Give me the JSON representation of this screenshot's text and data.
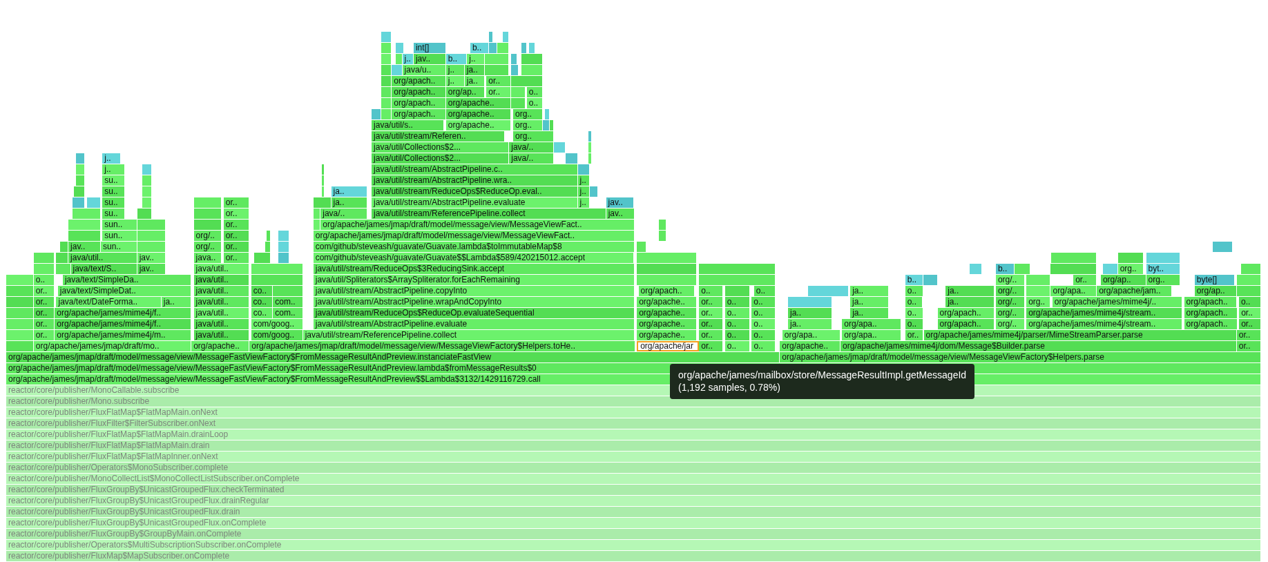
{
  "flame_graph": {
    "rows": [
      {
        "frames": [
          {
            "kind": "inlined"
          },
          {
            "kind": "inlined"
          },
          {
            "kind": "inlined"
          }
        ]
      },
      {
        "frames": [
          {
            "kind": "java"
          },
          {
            "kind": "inlined"
          },
          {
            "kind": "inlined",
            "label": "int[]"
          },
          {
            "kind": "inlined",
            "label": "b.."
          },
          {
            "kind": "inlined"
          },
          {
            "kind": "java"
          },
          {
            "kind": "inlined"
          },
          {
            "kind": "inlined"
          }
        ]
      },
      {
        "frames": [
          {
            "kind": "java"
          },
          {
            "kind": "java"
          },
          {
            "kind": "inlined",
            "label": "j.."
          },
          {
            "kind": "java",
            "label": "jav.."
          },
          {
            "kind": "inlined",
            "label": "b.."
          },
          {
            "kind": "java",
            "label": "j.."
          },
          {
            "kind": "java"
          },
          {
            "kind": "inlined"
          },
          {
            "kind": "java"
          }
        ]
      },
      {
        "frames": [
          {
            "kind": "java"
          },
          {
            "kind": "inlined"
          },
          {
            "kind": "java",
            "label": "java/u.."
          },
          {
            "kind": "java",
            "label": "j.."
          },
          {
            "kind": "java",
            "label": "ja.."
          },
          {
            "kind": "java"
          },
          {
            "kind": "inlined"
          },
          {
            "kind": "java"
          }
        ]
      },
      {
        "frames": [
          {
            "kind": "java"
          },
          {
            "kind": "java",
            "label": "org/apach.."
          },
          {
            "kind": "java",
            "label": "j.."
          },
          {
            "kind": "java",
            "label": "ja.."
          },
          {
            "kind": "java",
            "label": "or.."
          },
          {
            "kind": "java"
          }
        ]
      },
      {
        "frames": [
          {
            "kind": "java"
          },
          {
            "kind": "java",
            "label": "org/apach.."
          },
          {
            "kind": "java",
            "label": "org/ap.."
          },
          {
            "kind": "java",
            "label": "or.."
          },
          {
            "kind": "java"
          },
          {
            "kind": "java",
            "label": "o.."
          }
        ]
      },
      {
        "frames": [
          {
            "kind": "java"
          },
          {
            "kind": "java",
            "label": "org/apach.."
          },
          {
            "kind": "java",
            "label": "org/apache.."
          },
          {
            "kind": "java"
          },
          {
            "kind": "java",
            "label": "o.."
          }
        ]
      },
      {
        "frames": [
          {
            "kind": "inlined"
          },
          {
            "kind": "java"
          },
          {
            "kind": "java",
            "label": "org/apach.."
          },
          {
            "kind": "java",
            "label": "org/apache.."
          },
          {
            "kind": "java",
            "label": "org.."
          },
          {
            "kind": "inlined"
          }
        ]
      },
      {
        "frames": [
          {
            "kind": "java",
            "label": "java/util/s.."
          },
          {
            "kind": "java",
            "label": "org/apache.."
          },
          {
            "kind": "java",
            "label": "org.."
          },
          {
            "kind": "inlined"
          },
          {
            "kind": "java"
          }
        ]
      },
      {
        "frames": [
          {
            "kind": "java",
            "label": "java/util/stream/Referen.."
          },
          {
            "kind": "java",
            "label": "org.."
          },
          {
            "kind": "inlined"
          }
        ]
      },
      {
        "frames": [
          {
            "kind": "java",
            "label": "java/util/Collections$2..."
          },
          {
            "kind": "java",
            "label": "java/.."
          },
          {
            "kind": "inlined"
          },
          {
            "kind": "java"
          }
        ]
      },
      {
        "frames": [
          {
            "kind": "inlined"
          },
          {
            "kind": "inlined",
            "label": "j.."
          },
          {
            "kind": "java",
            "label": "java/util/Collections$2..."
          },
          {
            "kind": "java",
            "label": "java/.."
          },
          {
            "kind": "inlined"
          },
          {
            "kind": "java"
          }
        ]
      },
      {
        "frames": [
          {
            "kind": "java"
          },
          {
            "kind": "java",
            "label": "j.."
          },
          {
            "kind": "inlined"
          },
          {
            "kind": "java"
          },
          {
            "kind": "java",
            "label": "java/util/stream/AbstractPipeline.c.."
          },
          {
            "kind": "inlined"
          }
        ]
      },
      {
        "frames": [
          {
            "kind": "java"
          },
          {
            "kind": "java",
            "label": "su.."
          },
          {
            "kind": "java"
          },
          {
            "kind": "java"
          },
          {
            "kind": "java",
            "label": "java/util/stream/AbstractPipeline.wra.."
          },
          {
            "kind": "java",
            "label": "j.."
          }
        ]
      },
      {
        "frames": [
          {
            "kind": "java"
          },
          {
            "kind": "java",
            "label": "su.."
          },
          {
            "kind": "java"
          },
          {
            "kind": "java"
          },
          {
            "kind": "inlined",
            "label": "ja.."
          },
          {
            "kind": "java",
            "label": "java/util/stream/ReduceOps$ReduceOp.eval.."
          },
          {
            "kind": "java",
            "label": "j.."
          },
          {
            "kind": "inlined"
          }
        ]
      },
      {
        "frames": [
          {
            "kind": "inlined"
          },
          {
            "kind": "inlined"
          },
          {
            "kind": "java",
            "label": "su.."
          },
          {
            "kind": "java"
          },
          {
            "kind": "java"
          },
          {
            "kind": "java",
            "label": "or.."
          },
          {
            "kind": "java"
          },
          {
            "kind": "java",
            "label": "ja.."
          },
          {
            "kind": "java",
            "label": "java/util/stream/AbstractPipeline.evaluate"
          },
          {
            "kind": "java",
            "label": "j.."
          },
          {
            "kind": "inlined",
            "label": "jav.."
          }
        ]
      },
      {
        "frames": [
          {
            "kind": "java"
          },
          {
            "kind": "java",
            "label": "su.."
          },
          {
            "kind": "java"
          },
          {
            "kind": "java"
          },
          {
            "kind": "java",
            "label": "or.."
          },
          {
            "kind": "java"
          },
          {
            "kind": "java",
            "label": "java/.."
          },
          {
            "kind": "java",
            "label": "java/util/stream/ReferencePipeline.collect"
          },
          {
            "kind": "java",
            "label": "jav.."
          }
        ]
      },
      {
        "frames": [
          {
            "kind": "java"
          },
          {
            "kind": "java",
            "label": "sun.."
          },
          {
            "kind": "java"
          },
          {
            "kind": "java"
          },
          {
            "kind": "java",
            "label": "or.."
          },
          {
            "kind": "java"
          },
          {
            "kind": "java",
            "label": "org/apache/james/jmap/draft/model/message/view/MessageViewFact.."
          },
          {
            "kind": "java"
          }
        ]
      },
      {
        "frames": [
          {
            "kind": "java"
          },
          {
            "kind": "java",
            "label": "sun.."
          },
          {
            "kind": "java"
          },
          {
            "kind": "java",
            "label": "org/.."
          },
          {
            "kind": "java",
            "label": "or.."
          },
          {
            "kind": "java"
          },
          {
            "kind": "inlined"
          },
          {
            "kind": "java",
            "label": "org/apache/james/jmap/draft/model/message/view/MessageViewFact.."
          },
          {
            "kind": "java"
          }
        ]
      },
      {
        "frames": [
          {
            "kind": "java"
          },
          {
            "kind": "java",
            "label": "jav.."
          },
          {
            "kind": "java",
            "label": "sun.."
          },
          {
            "kind": "java"
          },
          {
            "kind": "java",
            "label": "org/.."
          },
          {
            "kind": "java",
            "label": "or.."
          },
          {
            "kind": "java"
          },
          {
            "kind": "inlined"
          },
          {
            "kind": "java",
            "label": "com/github/steveash/guavate/Guavate.lambda$toImmutableMap$8"
          },
          {
            "kind": "java"
          },
          {
            "kind": "inlined"
          }
        ]
      },
      {
        "frames": [
          {
            "kind": "java"
          },
          {
            "kind": "java"
          },
          {
            "kind": "java",
            "label": "java/util.."
          },
          {
            "kind": "java",
            "label": "jav.."
          },
          {
            "kind": "java",
            "label": "java.."
          },
          {
            "kind": "java",
            "label": "or.."
          },
          {
            "kind": "java"
          },
          {
            "kind": "inlined"
          },
          {
            "kind": "java",
            "label": "com/github/steveash/guavate/Guavate$$Lambda$589/420215012.accept"
          },
          {
            "kind": "java"
          },
          {
            "kind": "java"
          },
          {
            "kind": "java"
          },
          {
            "kind": "inlined"
          }
        ]
      },
      {
        "frames": [
          {
            "kind": "java"
          },
          {
            "kind": "java"
          },
          {
            "kind": "java",
            "label": "java/text/S.."
          },
          {
            "kind": "java",
            "label": "jav.."
          },
          {
            "kind": "java",
            "label": "java/util.."
          },
          {
            "kind": "java"
          },
          {
            "kind": "java",
            "label": "java/util/stream/ReduceOps$3ReducingSink.accept"
          },
          {
            "kind": "java"
          },
          {
            "kind": "java"
          },
          {
            "kind": "inlined"
          },
          {
            "kind": "inlined",
            "label": "b.."
          },
          {
            "kind": "java"
          },
          {
            "kind": "java"
          },
          {
            "kind": "inlined"
          },
          {
            "kind": "java",
            "label": "org.."
          },
          {
            "kind": "inlined",
            "label": "byt.."
          },
          {
            "kind": "java"
          }
        ]
      },
      {
        "frames": [
          {
            "kind": "java"
          },
          {
            "kind": "java",
            "label": "o.."
          },
          {
            "kind": "java",
            "label": "java/text/SimpleDa.."
          },
          {
            "kind": "java",
            "label": "java/util.."
          },
          {
            "kind": "java"
          },
          {
            "kind": "java",
            "label": "java/util/Spliterators$ArraySpliterator.forEachRemaining"
          },
          {
            "kind": "java"
          },
          {
            "kind": "java"
          },
          {
            "kind": "inlined",
            "label": "b.."
          },
          {
            "kind": "inlined"
          },
          {
            "kind": "java",
            "label": "org/.."
          },
          {
            "kind": "java"
          },
          {
            "kind": "java",
            "label": "or.."
          },
          {
            "kind": "java",
            "label": "org/ap.."
          },
          {
            "kind": "java",
            "label": "org.."
          },
          {
            "kind": "inlined",
            "label": "byte[]"
          },
          {
            "kind": "java"
          }
        ]
      },
      {
        "frames": [
          {
            "kind": "java"
          },
          {
            "kind": "java",
            "label": "or.."
          },
          {
            "kind": "java",
            "label": "java/text/SimpleDat.."
          },
          {
            "kind": "java",
            "label": "java/util.."
          },
          {
            "kind": "java",
            "label": "co.."
          },
          {
            "kind": "java"
          },
          {
            "kind": "java",
            "label": "java/util/stream/AbstractPipeline.copyInto"
          },
          {
            "kind": "java",
            "label": "org/apach.."
          },
          {
            "kind": "java",
            "label": "o.."
          },
          {
            "kind": "java"
          },
          {
            "kind": "java",
            "label": "o.."
          },
          {
            "kind": "inlined"
          },
          {
            "kind": "java",
            "label": "ja.."
          },
          {
            "kind": "java",
            "label": "o.."
          },
          {
            "kind": "java",
            "label": "ja.."
          },
          {
            "kind": "java",
            "label": "org/.."
          },
          {
            "kind": "java"
          },
          {
            "kind": "java",
            "label": "org/apa.."
          },
          {
            "kind": "java",
            "label": "org/apache/jam.."
          },
          {
            "kind": "java",
            "label": "org/ap.."
          },
          {
            "kind": "java"
          }
        ]
      },
      {
        "frames": [
          {
            "kind": "java"
          },
          {
            "kind": "java",
            "label": "or.."
          },
          {
            "kind": "java",
            "label": "java/text/DateForma.."
          },
          {
            "kind": "java",
            "label": "ja.."
          },
          {
            "kind": "java",
            "label": "java/util.."
          },
          {
            "kind": "java",
            "label": "co.."
          },
          {
            "kind": "java",
            "label": "com.."
          },
          {
            "kind": "java",
            "label": "java/util/stream/AbstractPipeline.wrapAndCopyInto"
          },
          {
            "kind": "java",
            "label": "org/apache.."
          },
          {
            "kind": "java",
            "label": "or.."
          },
          {
            "kind": "java",
            "label": "o.."
          },
          {
            "kind": "java",
            "label": "o.."
          },
          {
            "kind": "inlined"
          },
          {
            "kind": "java",
            "label": "ja.."
          },
          {
            "kind": "java",
            "label": "o.."
          },
          {
            "kind": "java",
            "label": "ja.."
          },
          {
            "kind": "java",
            "label": "org/.."
          },
          {
            "kind": "java",
            "label": "org.."
          },
          {
            "kind": "java",
            "label": "org/apache/james/mime4j/.."
          },
          {
            "kind": "java",
            "label": "org/apach.."
          },
          {
            "kind": "java",
            "label": "o.."
          }
        ]
      },
      {
        "frames": [
          {
            "kind": "java"
          },
          {
            "kind": "java",
            "label": "or.."
          },
          {
            "kind": "java",
            "label": "org/apache/james/mime4j/f.."
          },
          {
            "kind": "java",
            "label": "java/util.."
          },
          {
            "kind": "java",
            "label": "co.."
          },
          {
            "kind": "java",
            "label": "com.."
          },
          {
            "kind": "java",
            "label": "java/util/stream/ReduceOps$ReduceOp.evaluateSequential"
          },
          {
            "kind": "java",
            "label": "org/apache.."
          },
          {
            "kind": "java",
            "label": "or.."
          },
          {
            "kind": "java",
            "label": "o.."
          },
          {
            "kind": "java",
            "label": "o.."
          },
          {
            "kind": "java",
            "label": "ja.."
          },
          {
            "kind": "java",
            "label": "ja.."
          },
          {
            "kind": "java",
            "label": "o.."
          },
          {
            "kind": "java",
            "label": "org/apach.."
          },
          {
            "kind": "java",
            "label": "org/.."
          },
          {
            "kind": "java",
            "label": "org/apache/james/mime4j/stream.."
          },
          {
            "kind": "java",
            "label": "org/apach.."
          },
          {
            "kind": "java",
            "label": "or.."
          }
        ]
      },
      {
        "frames": [
          {
            "kind": "java"
          },
          {
            "kind": "java",
            "label": "or.."
          },
          {
            "kind": "java",
            "label": "org/apache/james/mime4j/f.."
          },
          {
            "kind": "java",
            "label": "java/util.."
          },
          {
            "kind": "java",
            "label": "com/goog.."
          },
          {
            "kind": "java",
            "label": "java/util/stream/AbstractPipeline.evaluate"
          },
          {
            "kind": "java",
            "label": "org/apache.."
          },
          {
            "kind": "java",
            "label": "or.."
          },
          {
            "kind": "java",
            "label": "o.."
          },
          {
            "kind": "java",
            "label": "o.."
          },
          {
            "kind": "java",
            "label": "ja.."
          },
          {
            "kind": "java",
            "label": "org/apa.."
          },
          {
            "kind": "java",
            "label": "o.."
          },
          {
            "kind": "java",
            "label": "org/apach.."
          },
          {
            "kind": "java",
            "label": "org/.."
          },
          {
            "kind": "java",
            "label": "org/apache/james/mime4j/stream.."
          },
          {
            "kind": "java",
            "label": "org/apach.."
          },
          {
            "kind": "java",
            "label": "or.."
          }
        ]
      },
      {
        "frames": [
          {
            "kind": "java"
          },
          {
            "kind": "java",
            "label": "or.."
          },
          {
            "kind": "java",
            "label": "org/apache/james/mime4j/m.."
          },
          {
            "kind": "java",
            "label": "java/util.."
          },
          {
            "kind": "java",
            "label": "com/goog.."
          },
          {
            "kind": "java",
            "label": "java/util/stream/ReferencePipeline.collect"
          },
          {
            "kind": "java",
            "label": "org/apache.."
          },
          {
            "kind": "java",
            "label": "or.."
          },
          {
            "kind": "java",
            "label": "o.."
          },
          {
            "kind": "java",
            "label": "o.."
          },
          {
            "kind": "java",
            "label": "org/apa.."
          },
          {
            "kind": "java",
            "label": "org/apa.."
          },
          {
            "kind": "java",
            "label": "or.."
          },
          {
            "kind": "java",
            "label": "org/apache/james/mime4j/parser/MimeStreamParser.parse"
          },
          {
            "kind": "java",
            "label": "or.."
          }
        ]
      },
      {
        "frames": [
          {
            "kind": "java"
          },
          {
            "kind": "java",
            "label": "org/apache/james/jmap/draft/mo.."
          },
          {
            "kind": "java",
            "label": "org/apache.."
          },
          {
            "kind": "java",
            "label": "org/apache/james/jmap/draft/model/message/view/MessageViewFactory$Helpers.toHe.."
          },
          {
            "kind": "highlight",
            "label": "org/apache/jar"
          },
          {
            "kind": "java",
            "label": "or.."
          },
          {
            "kind": "java",
            "label": "o.."
          },
          {
            "kind": "java",
            "label": "o.."
          },
          {
            "kind": "java",
            "label": "org/apache.."
          },
          {
            "kind": "java",
            "label": "org/apache/james/mime4j/dom/Message$Builder.parse"
          },
          {
            "kind": "java",
            "label": "or.."
          }
        ]
      },
      {
        "frames": [
          {
            "kind": "java",
            "label": "org/apache/james/jmap/draft/model/message/view/MessageFastViewFactory$FromMessageResultAndPreview.instanciateFastView"
          },
          {
            "kind": "java",
            "label": "org/apache/james/jmap/draft/model/message/view/MessageViewFactory$Helpers.parse"
          }
        ]
      },
      {
        "frames": [
          {
            "kind": "java",
            "label": "org/apache/james/jmap/draft/model/message/view/MessageFastViewFactory$FromMessageResultAndPreview.lambda$fromMessageResults$0"
          }
        ]
      },
      {
        "frames": [
          {
            "kind": "java",
            "label": "org/apache/james/jmap/draft/model/message/view/MessageFastViewFactory$FromMessageResultAndPreview$$Lambda$3132/1429116729.call"
          }
        ]
      },
      {
        "frames": [
          {
            "kind": "dimmed",
            "label": "reactor/core/publisher/MonoCallable.subscribe"
          }
        ]
      },
      {
        "frames": [
          {
            "kind": "dimmed",
            "label": "reactor/core/publisher/Mono.subscribe"
          }
        ]
      },
      {
        "frames": [
          {
            "kind": "dimmed",
            "label": "reactor/core/publisher/FluxFlatMap$FlatMapMain.onNext"
          }
        ]
      },
      {
        "frames": [
          {
            "kind": "dimmed",
            "label": "reactor/core/publisher/FluxFilter$FilterSubscriber.onNext"
          }
        ]
      },
      {
        "frames": [
          {
            "kind": "dimmed",
            "label": "reactor/core/publisher/FluxFlatMap$FlatMapMain.drainLoop"
          }
        ]
      },
      {
        "frames": [
          {
            "kind": "dimmed",
            "label": "reactor/core/publisher/FluxFlatMap$FlatMapMain.drain"
          }
        ]
      },
      {
        "frames": [
          {
            "kind": "dimmed",
            "label": "reactor/core/publisher/FluxFlatMap$FlatMapInner.onNext"
          }
        ]
      },
      {
        "frames": [
          {
            "kind": "dimmed",
            "label": "reactor/core/publisher/Operators$MonoSubscriber.complete"
          }
        ]
      },
      {
        "frames": [
          {
            "kind": "dimmed",
            "label": "reactor/core/publisher/MonoCollectList$MonoCollectListSubscriber.onComplete"
          }
        ]
      },
      {
        "frames": [
          {
            "kind": "dimmed",
            "label": "reactor/core/publisher/FluxGroupBy$UnicastGroupedFlux.checkTerminated"
          }
        ]
      },
      {
        "frames": [
          {
            "kind": "dimmed",
            "label": "reactor/core/publisher/FluxGroupBy$UnicastGroupedFlux.drainRegular"
          }
        ]
      },
      {
        "frames": [
          {
            "kind": "dimmed",
            "label": "reactor/core/publisher/FluxGroupBy$UnicastGroupedFlux.drain"
          }
        ]
      },
      {
        "frames": [
          {
            "kind": "dimmed",
            "label": "reactor/core/publisher/FluxGroupBy$UnicastGroupedFlux.onComplete"
          }
        ]
      },
      {
        "frames": [
          {
            "kind": "dimmed",
            "label": "reactor/core/publisher/FluxGroupBy$GroupByMain.onComplete"
          }
        ]
      },
      {
        "frames": [
          {
            "kind": "dimmed",
            "label": "reactor/core/publisher/Operators$MultiSubscriptionSubscriber.onComplete"
          }
        ]
      },
      {
        "frames": [
          {
            "kind": "dimmed",
            "label": "reactor/core/publisher/FluxMap$MapSubscriber.onComplete"
          }
        ]
      }
    ]
  },
  "tooltip": {
    "title": "org/apache/james/mailbox/store/MessageResultImpl.getMessageId",
    "detail": "(1,192 samples, 0.78%)"
  }
}
